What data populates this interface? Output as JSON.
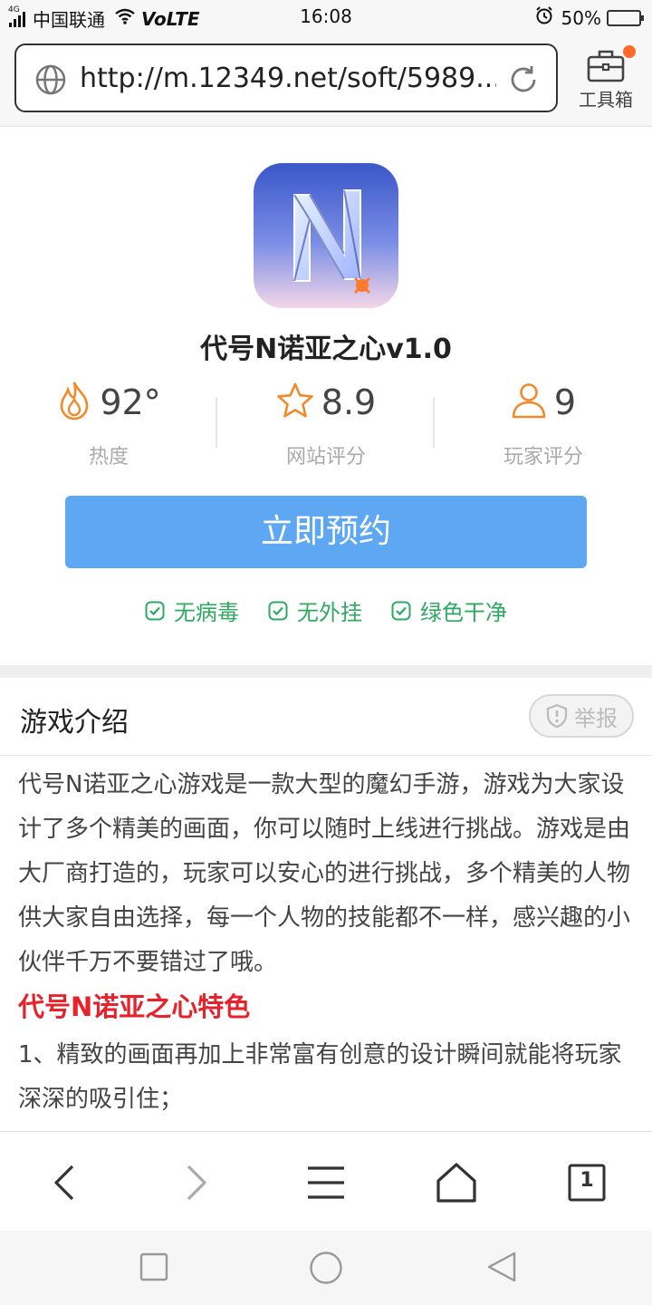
{
  "status_bar": {
    "carrier": "中国联通",
    "network_tag": "4G",
    "volte": "VoLTE",
    "time": "16:08",
    "battery_text": "50%",
    "battery_level": 0.5
  },
  "browser": {
    "url": "http://m.12349.net/soft/5989...",
    "toolbox_label": "工具箱"
  },
  "app": {
    "name": "代号N诺亚之心v1.0",
    "stats": [
      {
        "value": "92°",
        "caption": "热度",
        "icon": "flame-icon"
      },
      {
        "value": "8.9",
        "caption": "网站评分",
        "icon": "star-icon"
      },
      {
        "value": "9",
        "caption": "玩家评分",
        "icon": "user-icon"
      }
    ],
    "reserve_label": "立即预约",
    "badges": [
      "无病毒",
      "无外挂",
      "绿色干净"
    ]
  },
  "intro": {
    "title": "游戏介绍",
    "report_label": "举报",
    "body": "代号N诺亚之心游戏是一款大型的魔幻手游，游戏为大家设计了多个精美的画面，你可以随时上线进行挑战。游戏是由大厂商打造的，玩家可以安心的进行挑战，多个精美的人物供大家自由选择，每一个人物的技能都不一样，感兴趣的小伙伴千万不要错过了哦。",
    "feature_title": "代号N诺亚之心特色",
    "feature_1": "1、精致的画面再加上非常富有创意的设计瞬间就能将玩家深深的吸引住；"
  },
  "bottom_nav": {
    "tab_count": "1"
  },
  "colors": {
    "accent_blue": "#5ea7f2",
    "icon_orange": "#f08a2b",
    "check_green": "#2fa862",
    "feature_red": "#e8222b",
    "notify_dot": "#ff6a2c"
  }
}
